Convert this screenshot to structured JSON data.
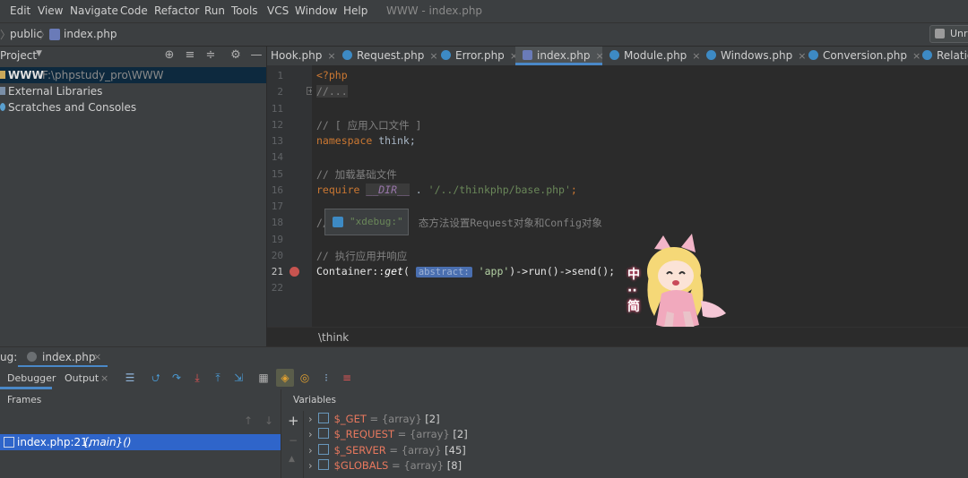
{
  "menu": [
    "Edit",
    "View",
    "Navigate",
    "Code",
    "Refactor",
    "Run",
    "Tools",
    "VCS",
    "Window",
    "Help"
  ],
  "window_title": "WWW - index.php",
  "navbar": {
    "crumb1": "public",
    "crumb2": "index.php",
    "run_config": "Unr"
  },
  "project": {
    "title": "Project",
    "tree": [
      {
        "label": "WWW",
        "path": "F:\\phpstudy_pro\\WWW"
      },
      {
        "label": "External Libraries"
      },
      {
        "label": "Scratches and Consoles"
      }
    ]
  },
  "tabs": [
    "Hook.php",
    "Request.php",
    "Error.php",
    "index.php",
    "Module.php",
    "Windows.php",
    "Conversion.php",
    "Relation"
  ],
  "active_tab": "index.php",
  "line_numbers": [
    "1",
    "2",
    "11",
    "12",
    "13",
    "14",
    "15",
    "16",
    "17",
    "18",
    "19",
    "20",
    "21",
    "22"
  ],
  "code": {
    "l1": "<?php",
    "l2": "//...",
    "l12": "// [ 应用入口文件 ]",
    "l13_kw": "namespace",
    "l13_rest": " think;",
    "l15": "// 加载基础文件",
    "l16_kw": "require",
    "l16_const": "__DIR__",
    "l16_dot": " . ",
    "l16_str": "'/../thinkphp/base.php'",
    "l16_end": ";",
    "l18_start": "//",
    "l18_rest": "态方法设置Request对象和Config对象",
    "l20": "// 执行应用并响应",
    "l21_a": "Container::",
    "l21_get": "get",
    "l21_paren": "(",
    "l21_hint": "abstract:",
    "l21_str": "'app'",
    "l21_b": ")->",
    "l21_run": "run",
    "l21_c": "()->",
    "l21_send": "send",
    "l21_d": "();"
  },
  "tooltip": "\"xdebug:\"",
  "editor_breadcrumb": "\\think",
  "debug": {
    "label": "ug:",
    "session_tab": "index.php",
    "subtabs": [
      "Debugger",
      "Output"
    ],
    "frames_title": "Frames",
    "frame_row": "index.php:21,",
    "frame_main": "{main}()",
    "vars_title": "Variables",
    "vars": [
      {
        "name": "$_GET",
        "type": "{array}",
        "count": "[2]"
      },
      {
        "name": "$_REQUEST",
        "type": "{array}",
        "count": "[2]"
      },
      {
        "name": "$_SERVER",
        "type": "{array}",
        "count": "[45]"
      },
      {
        "name": "$GLOBALS",
        "type": "{array}",
        "count": "[8]"
      }
    ]
  },
  "sticker_text": "中\n··\n简"
}
